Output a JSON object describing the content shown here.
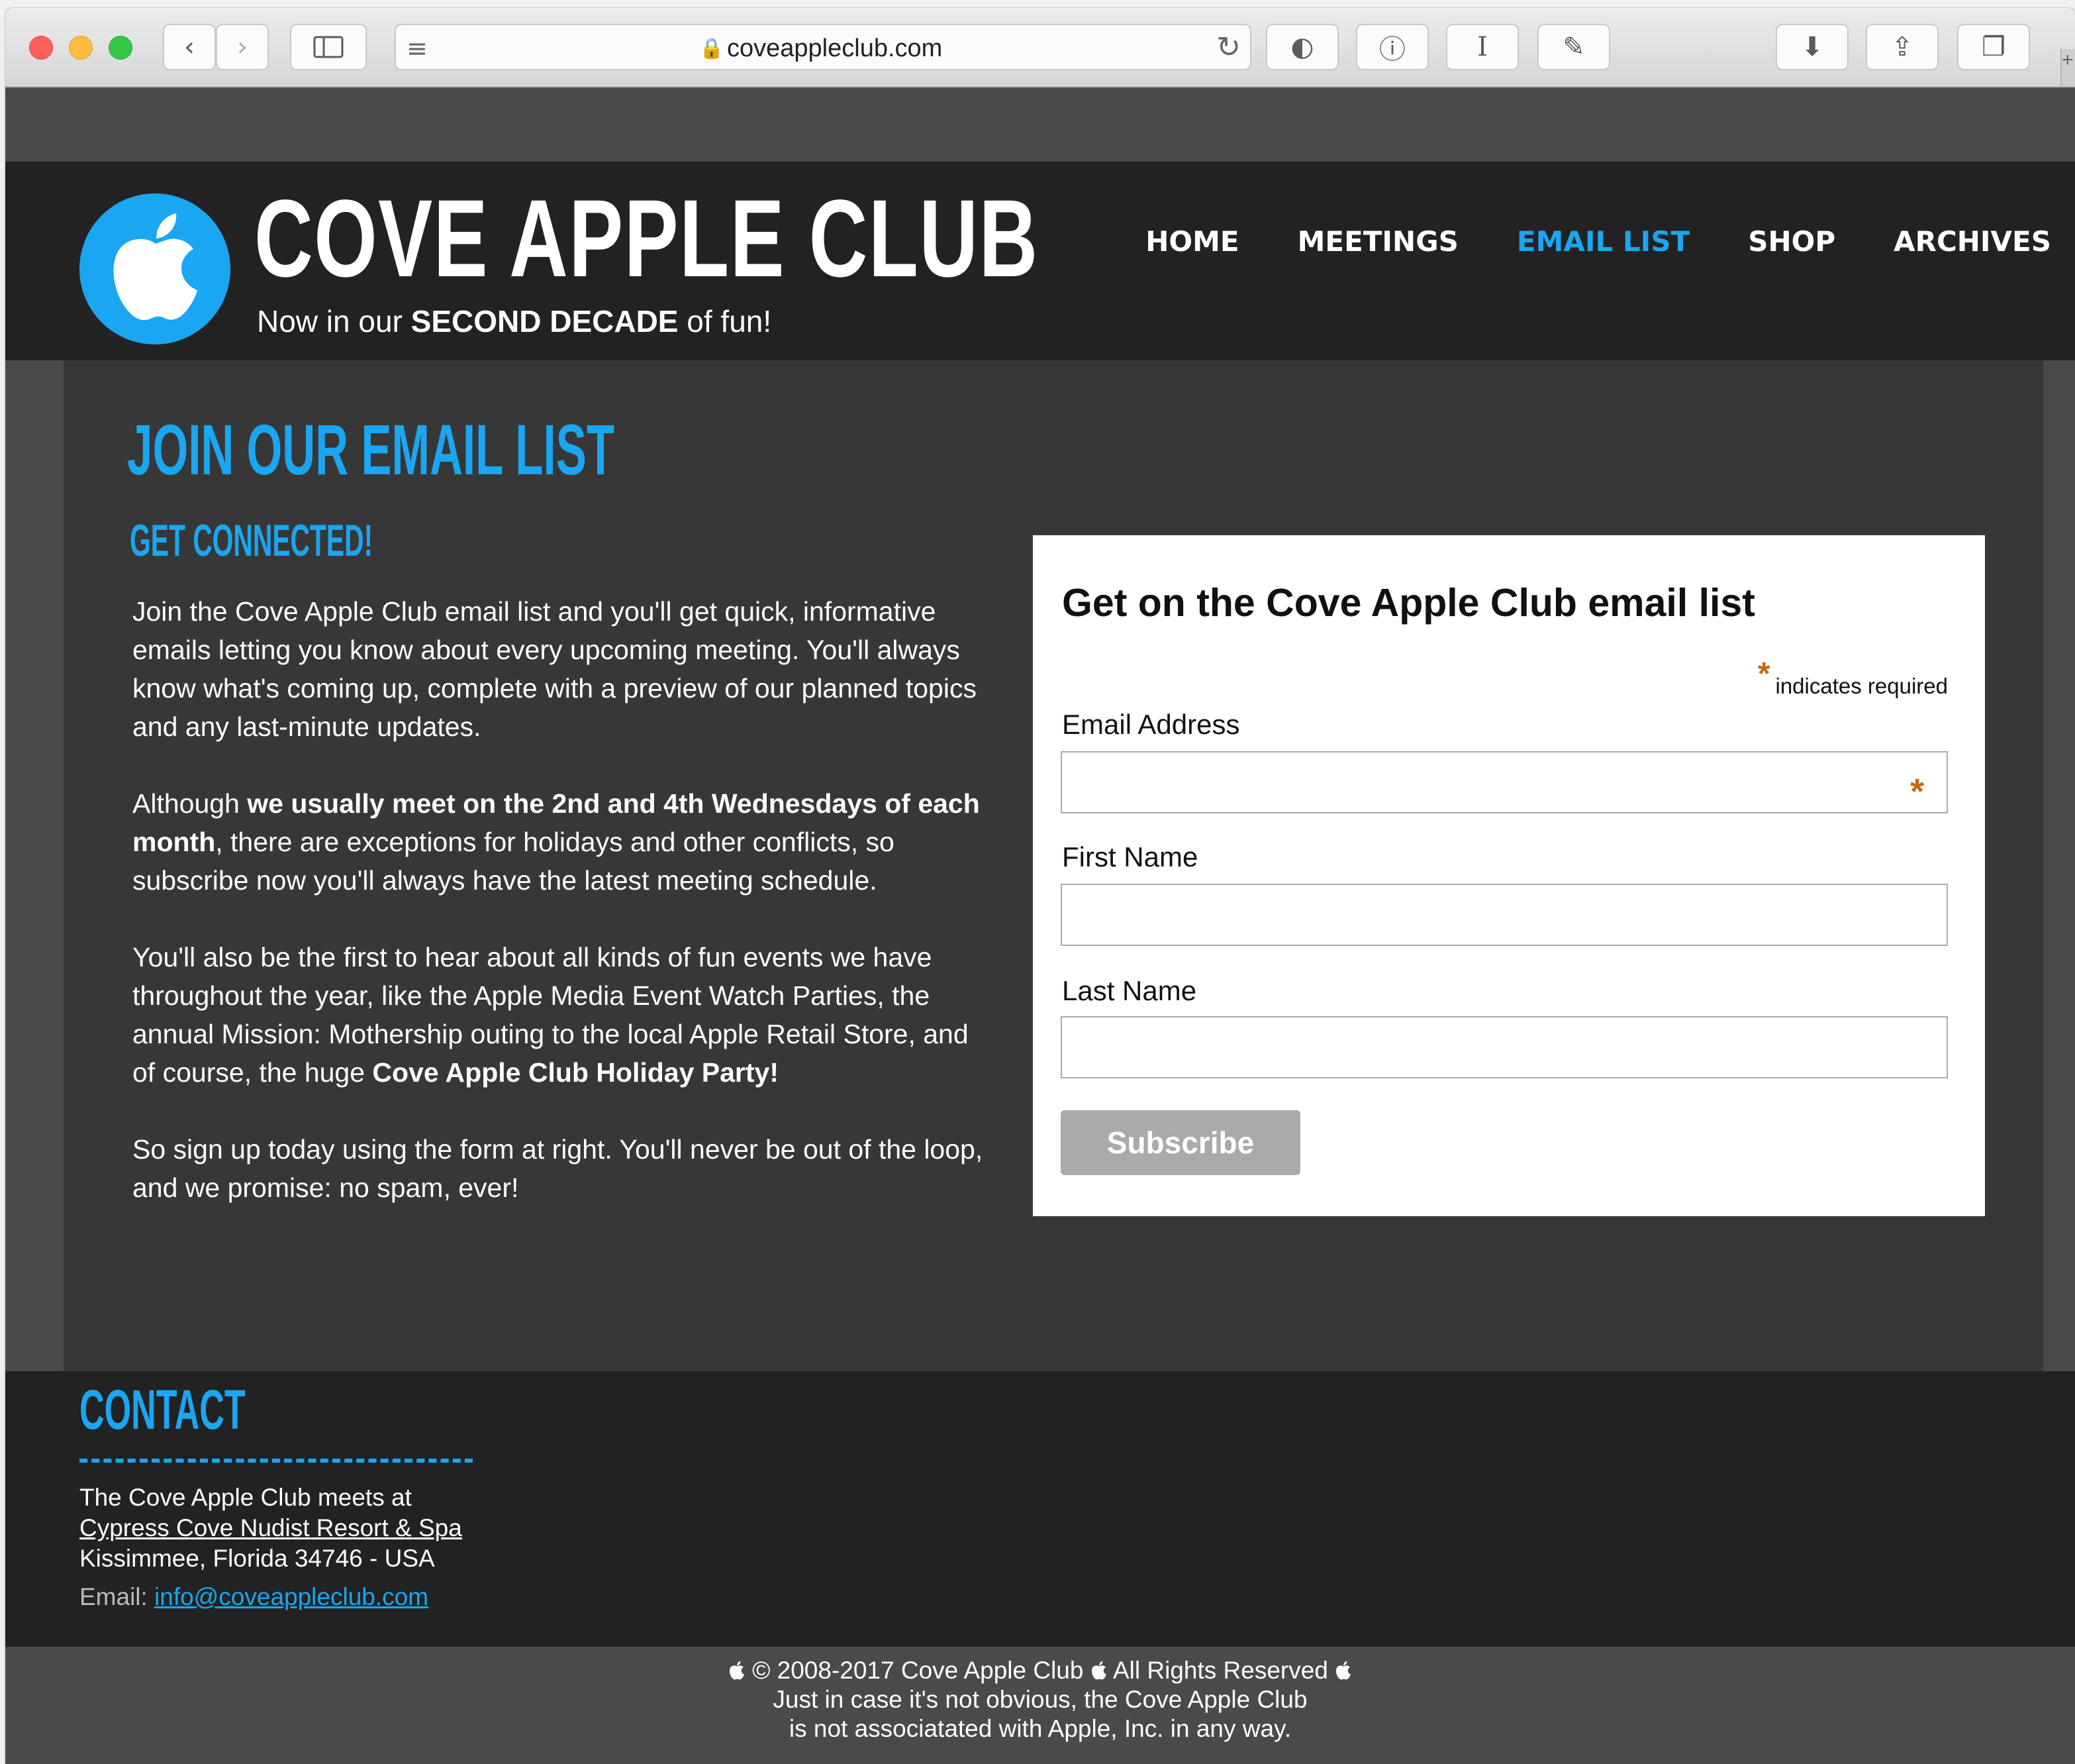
{
  "browser": {
    "url": "coveappleclub.com"
  },
  "site": {
    "title": "COVE APPLE CLUB",
    "tagline_pre": "Now in our ",
    "tagline_bold": "SECOND DECADE",
    "tagline_post": " of fun!",
    "nav": [
      "HOME",
      "MEETINGS",
      "EMAIL LIST",
      "SHOP",
      "ARCHIVES"
    ],
    "active_nav": "EMAIL LIST",
    "accent_color": "#1aa6f0"
  },
  "main": {
    "heading": "JOIN OUR EMAIL LIST",
    "subheading": "GET CONNECTED!",
    "p1": "Join the Cove Apple Club email list and you'll get quick, informative emails letting you know about every upcoming meeting. You'll always know what's coming up, complete with a preview of our planned topics and any last-minute updates.",
    "p2_a": "Although ",
    "p2_b": "we usually meet on the 2nd and 4th Wednesdays of each month",
    "p2_c": ", there are exceptions for holidays and other conflicts, so subscribe now you'll always have the latest meeting schedule.",
    "p3_a": "You'll also be the first to hear about all kinds of fun events we have throughout the year, like the Apple Media Event Watch Parties, the annual Mission: Mothership outing to the local Apple Retail Store, and of course, the huge ",
    "p3_b": "Cove Apple Club Holiday Party!",
    "p4": "So sign up today using the form at right. You'll never be out of the loop, and we promise: no spam, ever!"
  },
  "form": {
    "title": "Get on the Cove Apple Club email list",
    "required_star": "*",
    "required_note": "indicates required",
    "email_label": "Email Address",
    "email_value": "",
    "first_label": "First Name",
    "first_value": "",
    "last_label": "Last Name",
    "last_value": "",
    "subscribe_label": "Subscribe"
  },
  "footer": {
    "contact_heading": "CONTACT",
    "line1": "The Cove Apple Club meets at",
    "venue_link": "Cypress Cove Nudist Resort & Spa",
    "line3": "Kissimmee, Florida  34746 - USA",
    "email_label": "Email: ",
    "email_link": "info@coveappleclub.com"
  },
  "bottom": {
    "copyright": "© 2008-2017 Cove Apple Club",
    "rights": "All Rights Reserved",
    "line2": "Just in case it's not obvious, the Cove Apple Club",
    "line3": "is not associatated with Apple, Inc. in any way."
  }
}
